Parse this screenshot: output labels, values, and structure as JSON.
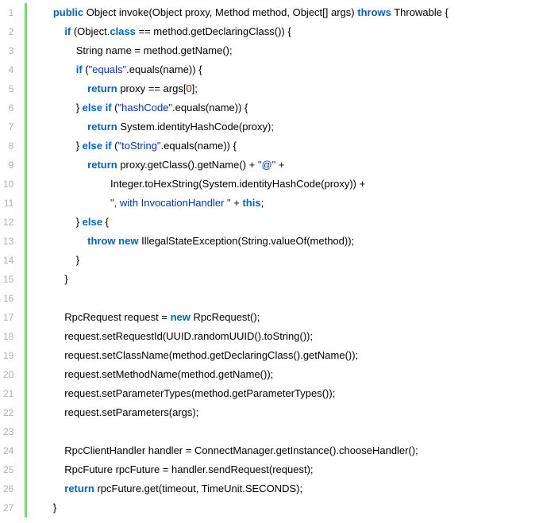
{
  "line_numbers": [
    "1",
    "2",
    "3",
    "4",
    "5",
    "6",
    "7",
    "8",
    "9",
    "10",
    "11",
    "12",
    "13",
    "14",
    "15",
    "16",
    "17",
    "18",
    "19",
    "20",
    "21",
    "22",
    "23",
    "24",
    "25",
    "26",
    "27"
  ],
  "code_lines": [
    {
      "indent": 1,
      "tokens": [
        {
          "t": "kw",
          "v": "public"
        },
        {
          "t": "pl",
          "v": " Object invoke(Object proxy, Method method, Object[] args) "
        },
        {
          "t": "kw",
          "v": "throws"
        },
        {
          "t": "pl",
          "v": " Throwable {"
        }
      ]
    },
    {
      "indent": 2,
      "tokens": [
        {
          "t": "kw",
          "v": "if"
        },
        {
          "t": "pl",
          "v": " (Object."
        },
        {
          "t": "kw",
          "v": "class"
        },
        {
          "t": "pl",
          "v": " == method.getDeclaringClass()) {"
        }
      ]
    },
    {
      "indent": 3,
      "tokens": [
        {
          "t": "pl",
          "v": "String name = method.getName();"
        }
      ]
    },
    {
      "indent": 3,
      "tokens": [
        {
          "t": "kw",
          "v": "if"
        },
        {
          "t": "pl",
          "v": " ("
        },
        {
          "t": "str",
          "v": "\"equals\""
        },
        {
          "t": "pl",
          "v": ".equals(name)) {"
        }
      ]
    },
    {
      "indent": 4,
      "tokens": [
        {
          "t": "kw",
          "v": "return"
        },
        {
          "t": "pl",
          "v": " proxy == args["
        },
        {
          "t": "num",
          "v": "0"
        },
        {
          "t": "pl",
          "v": "];"
        }
      ]
    },
    {
      "indent": 3,
      "tokens": [
        {
          "t": "pl",
          "v": "} "
        },
        {
          "t": "kw",
          "v": "else"
        },
        {
          "t": "pl",
          "v": " "
        },
        {
          "t": "kw",
          "v": "if"
        },
        {
          "t": "pl",
          "v": " ("
        },
        {
          "t": "str",
          "v": "\"hashCode\""
        },
        {
          "t": "pl",
          "v": ".equals(name)) {"
        }
      ]
    },
    {
      "indent": 4,
      "tokens": [
        {
          "t": "kw",
          "v": "return"
        },
        {
          "t": "pl",
          "v": " System.identityHashCode(proxy);"
        }
      ]
    },
    {
      "indent": 3,
      "tokens": [
        {
          "t": "pl",
          "v": "} "
        },
        {
          "t": "kw",
          "v": "else"
        },
        {
          "t": "pl",
          "v": " "
        },
        {
          "t": "kw",
          "v": "if"
        },
        {
          "t": "pl",
          "v": " ("
        },
        {
          "t": "str",
          "v": "\"toString\""
        },
        {
          "t": "pl",
          "v": ".equals(name)) {"
        }
      ]
    },
    {
      "indent": 4,
      "tokens": [
        {
          "t": "kw",
          "v": "return"
        },
        {
          "t": "pl",
          "v": " proxy.getClass().getName() + "
        },
        {
          "t": "str",
          "v": "\"@\""
        },
        {
          "t": "pl",
          "v": " +"
        }
      ]
    },
    {
      "indent": 6,
      "tokens": [
        {
          "t": "pl",
          "v": "Integer.toHexString(System.identityHashCode(proxy)) +"
        }
      ]
    },
    {
      "indent": 6,
      "tokens": [
        {
          "t": "str",
          "v": "\", with InvocationHandler \""
        },
        {
          "t": "pl",
          "v": " + "
        },
        {
          "t": "this",
          "v": "this"
        },
        {
          "t": "pl",
          "v": ";"
        }
      ]
    },
    {
      "indent": 3,
      "tokens": [
        {
          "t": "pl",
          "v": "} "
        },
        {
          "t": "kw",
          "v": "else"
        },
        {
          "t": "pl",
          "v": " {"
        }
      ]
    },
    {
      "indent": 4,
      "tokens": [
        {
          "t": "kw",
          "v": "throw"
        },
        {
          "t": "pl",
          "v": " "
        },
        {
          "t": "kw",
          "v": "new"
        },
        {
          "t": "pl",
          "v": " IllegalStateException(String.valueOf(method));"
        }
      ]
    },
    {
      "indent": 3,
      "tokens": [
        {
          "t": "pl",
          "v": "}"
        }
      ]
    },
    {
      "indent": 2,
      "tokens": [
        {
          "t": "pl",
          "v": "}"
        }
      ]
    },
    {
      "indent": 0,
      "tokens": []
    },
    {
      "indent": 2,
      "tokens": [
        {
          "t": "pl",
          "v": "RpcRequest request = "
        },
        {
          "t": "kw",
          "v": "new"
        },
        {
          "t": "pl",
          "v": " RpcRequest();"
        }
      ]
    },
    {
      "indent": 2,
      "tokens": [
        {
          "t": "pl",
          "v": "request.setRequestId(UUID.randomUUID().toString());"
        }
      ]
    },
    {
      "indent": 2,
      "tokens": [
        {
          "t": "pl",
          "v": "request.setClassName(method.getDeclaringClass().getName());"
        }
      ]
    },
    {
      "indent": 2,
      "tokens": [
        {
          "t": "pl",
          "v": "request.setMethodName(method.getName());"
        }
      ]
    },
    {
      "indent": 2,
      "tokens": [
        {
          "t": "pl",
          "v": "request.setParameterTypes(method.getParameterTypes());"
        }
      ]
    },
    {
      "indent": 2,
      "tokens": [
        {
          "t": "pl",
          "v": "request.setParameters(args);"
        }
      ]
    },
    {
      "indent": 0,
      "tokens": []
    },
    {
      "indent": 2,
      "tokens": [
        {
          "t": "pl",
          "v": "RpcClientHandler handler = ConnectManager.getInstance().chooseHandler();"
        }
      ]
    },
    {
      "indent": 2,
      "tokens": [
        {
          "t": "pl",
          "v": "RpcFuture rpcFuture = handler.sendRequest(request);"
        }
      ]
    },
    {
      "indent": 2,
      "tokens": [
        {
          "t": "kw",
          "v": "return"
        },
        {
          "t": "pl",
          "v": " rpcFuture.get(timeout, TimeUnit.SECONDS);"
        }
      ]
    },
    {
      "indent": 1,
      "tokens": [
        {
          "t": "pl",
          "v": "}"
        }
      ]
    }
  ],
  "indent_unit": "    "
}
